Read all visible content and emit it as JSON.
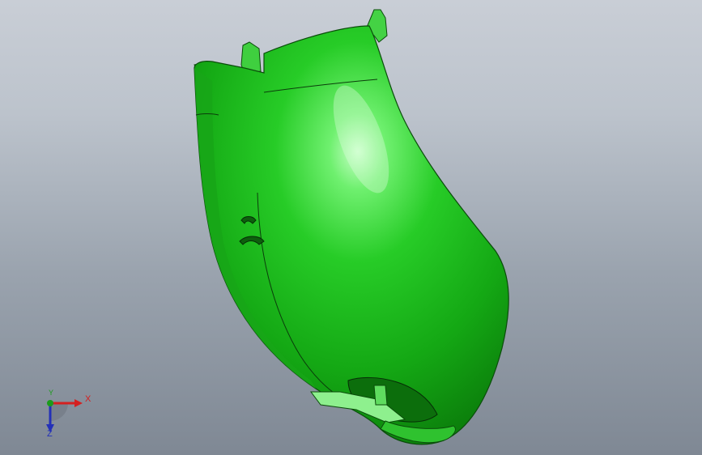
{
  "viewport": {
    "background_top": "#c9ced6",
    "background_bottom": "#7f8894"
  },
  "model": {
    "part_color": "#1fc11f",
    "shade_color": "#0e8d0e",
    "highlight_color": "#8df58d",
    "edge_color": "#0b3d0b"
  },
  "triad": {
    "x_label": "X",
    "y_label": "Y",
    "z_label": "Z",
    "x_color": "#d42020",
    "y_color": "#1b9c1b",
    "z_color": "#2330b8"
  }
}
